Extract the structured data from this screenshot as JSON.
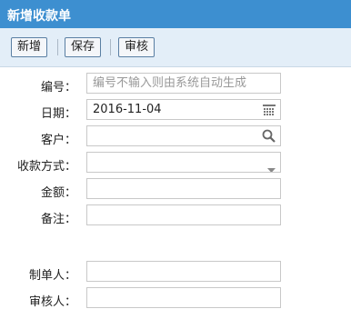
{
  "window": {
    "title": "新增收款单"
  },
  "toolbar": {
    "new_label": "新增",
    "save_label": "保存",
    "audit_label": "审核"
  },
  "form": {
    "number_label": "编号：",
    "number_placeholder": "编号不输入则由系统自动生成",
    "date_label": "日期：",
    "date_value": "2016-11-04",
    "customer_label": "客户：",
    "customer_value": "",
    "method_label": "收款方式：",
    "method_value": "",
    "amount_label": "金额：",
    "amount_value": "",
    "remark_label": "备注：",
    "remark_value": "",
    "creator_label": "制单人：",
    "creator_value": "",
    "auditor_label": "审核人：",
    "auditor_value": ""
  },
  "icons": {
    "date": "calendar-icon",
    "customer": "search-icon",
    "method": "chevron-down-icon"
  },
  "colors": {
    "titlebar": "#3d8fd0",
    "toolbar": "#e3eef8",
    "button_border": "#5a7fa3"
  }
}
